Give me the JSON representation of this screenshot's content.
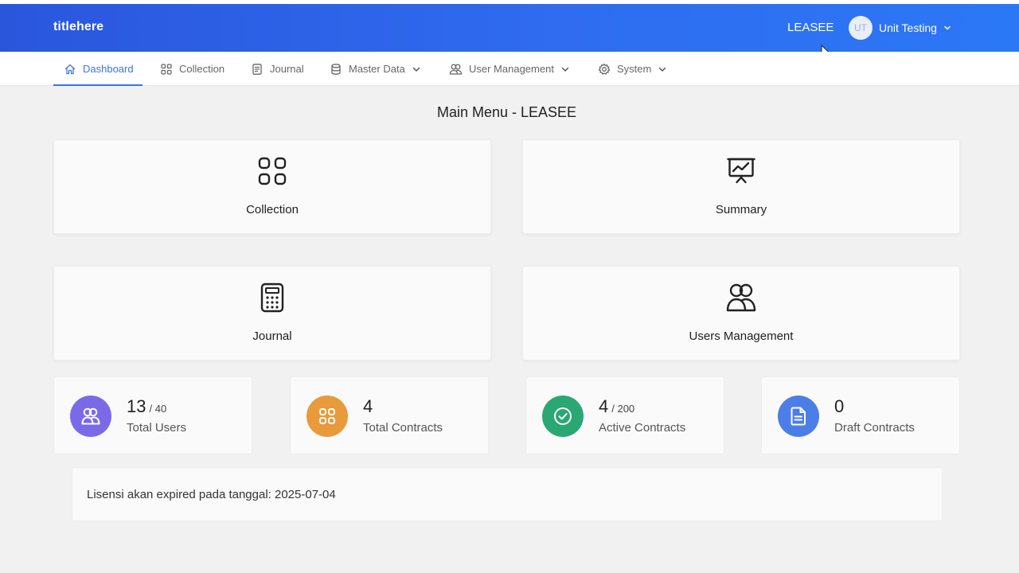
{
  "header": {
    "brand": "titlehere",
    "company": "LEASEE",
    "user": {
      "initials": "UT",
      "name": "Unit Testing"
    }
  },
  "nav": {
    "items": [
      {
        "label": "Dashboard",
        "icon": "home-icon",
        "active": true
      },
      {
        "label": "Collection",
        "icon": "grid-icon"
      },
      {
        "label": "Journal",
        "icon": "document-icon"
      },
      {
        "label": "Master Data",
        "icon": "database-icon",
        "dropdown": true
      },
      {
        "label": "User Management",
        "icon": "users-icon",
        "dropdown": true
      },
      {
        "label": "System",
        "icon": "gear-icon",
        "dropdown": true
      }
    ]
  },
  "main": {
    "title": "Main Menu - LEASEE",
    "menu_cards": [
      {
        "label": "Collection",
        "icon": "grid-icon"
      },
      {
        "label": "Summary",
        "icon": "presentation-chart-icon"
      },
      {
        "label": "Journal",
        "icon": "calculator-icon"
      },
      {
        "label": "Users Management",
        "icon": "users-icon"
      }
    ],
    "stats": [
      {
        "value": "13",
        "max": "/ 40",
        "label": "Total Users",
        "icon": "users-icon",
        "color": "#7b6ae8"
      },
      {
        "value": "4",
        "max": "",
        "label": "Total Contracts",
        "icon": "grid-icon",
        "color": "#e99a3a"
      },
      {
        "value": "4",
        "max": "/ 200",
        "label": "Active Contracts",
        "icon": "check-circle-icon",
        "color": "#2aa773"
      },
      {
        "value": "0",
        "max": "",
        "label": "Draft Contracts",
        "icon": "document-icon",
        "color": "#4c7ee8"
      }
    ],
    "license_text": "Lisensi akan expired pada tanggal: 2025-07-04"
  },
  "colors": {
    "header_start": "#2a56dc",
    "header_end": "#2b78f6",
    "nav_active": "#3b74e8"
  }
}
